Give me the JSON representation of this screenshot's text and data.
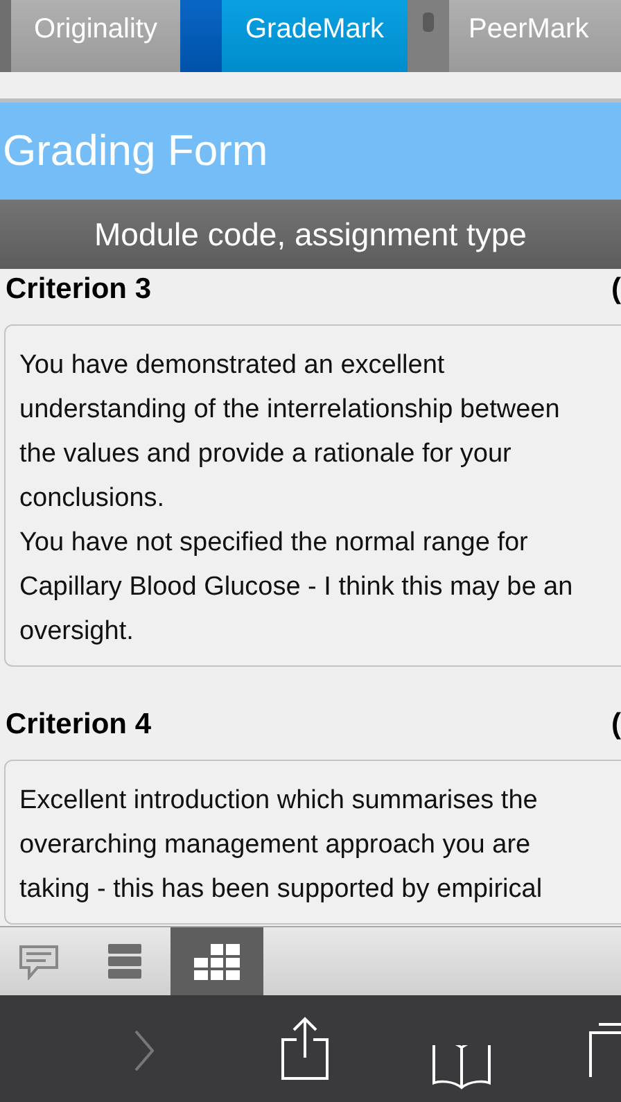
{
  "tabs": [
    {
      "label": "Originality",
      "selected": false
    },
    {
      "label": "GradeMark",
      "selected": true
    },
    {
      "label": "PeerMark",
      "selected": false
    }
  ],
  "header": {
    "title": "Grading Form",
    "subtitle": "Module code, assignment type"
  },
  "criteria": [
    {
      "title": "Criterion 3",
      "score": "(",
      "paragraphs": [
        "You have demonstrated an excellent understanding of the interrelationship between the values and provide a rationale for your conclusions.",
        "You have not specified the normal range for Capillary Blood Glucose - I think this may be an oversight."
      ]
    },
    {
      "title": "Criterion 4",
      "score": "(",
      "paragraphs": [
        "Excellent introduction which summarises the overarching management approach you are taking - this has been supported by empirical"
      ]
    }
  ],
  "tools": [
    {
      "kind": "comments",
      "selected": false
    },
    {
      "kind": "layers",
      "selected": false
    },
    {
      "kind": "grid",
      "selected": true
    }
  ],
  "browser_bar": {
    "forward_disabled": true
  }
}
